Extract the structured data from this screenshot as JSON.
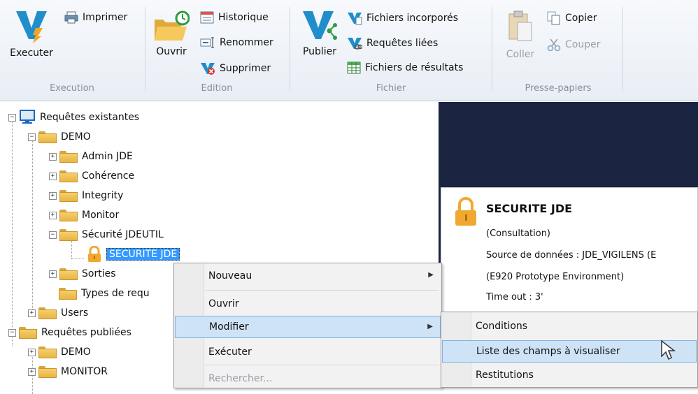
{
  "ribbon": {
    "groups": {
      "execution": {
        "label": "Execution",
        "executer": "Executer",
        "imprimer": "Imprimer"
      },
      "edition": {
        "label": "Edition",
        "ouvrir": "Ouvrir",
        "historique": "Historique",
        "renommer": "Renommer",
        "supprimer": "Supprimer"
      },
      "fichier": {
        "label": "Fichier",
        "publier": "Publier",
        "fichiers_incorpores": "Fichiers incorporés",
        "requetes_liees": "Requêtes liées",
        "fichiers_resultats": "Fichiers de résultats"
      },
      "presse_papiers": {
        "label": "Presse-papiers",
        "coller": "Coller",
        "copier": "Copier",
        "couper": "Couper"
      }
    }
  },
  "tree": {
    "root1": "Requêtes existantes",
    "demo": "DEMO",
    "admin_jde": "Admin JDE",
    "coherence": "Cohérence",
    "integrity": "Integrity",
    "monitor": "Monitor",
    "securite_jdeutil": "Sécurité JDEUTIL",
    "securite_jde": "SECURITE JDE",
    "sorties": "Sorties",
    "types": "Types de requ",
    "users": "Users",
    "root2": "Requêtes publiées",
    "pub_demo": "DEMO",
    "pub_monitor": "MONITOR"
  },
  "info": {
    "title": "SECURITE JDE",
    "mode": "(Consultation)",
    "source": "Source de données : JDE_VIGILENS   (E",
    "env": "(E920 Prototype Environment)",
    "timeout": "Time out : 3'"
  },
  "context_menu": {
    "nouveau": "Nouveau",
    "ouvrir": "Ouvrir",
    "modifier": "Modifier",
    "executer": "Exécuter",
    "rechercher": "Rechercher..."
  },
  "submenu": {
    "conditions": "Conditions",
    "liste_champs": "Liste des champs à visualiser",
    "restitutions": "Restitutions"
  },
  "colors": {
    "selection": "#3399ff",
    "navy": "#1b2440",
    "menu_highlight": "#cfe3f7"
  }
}
